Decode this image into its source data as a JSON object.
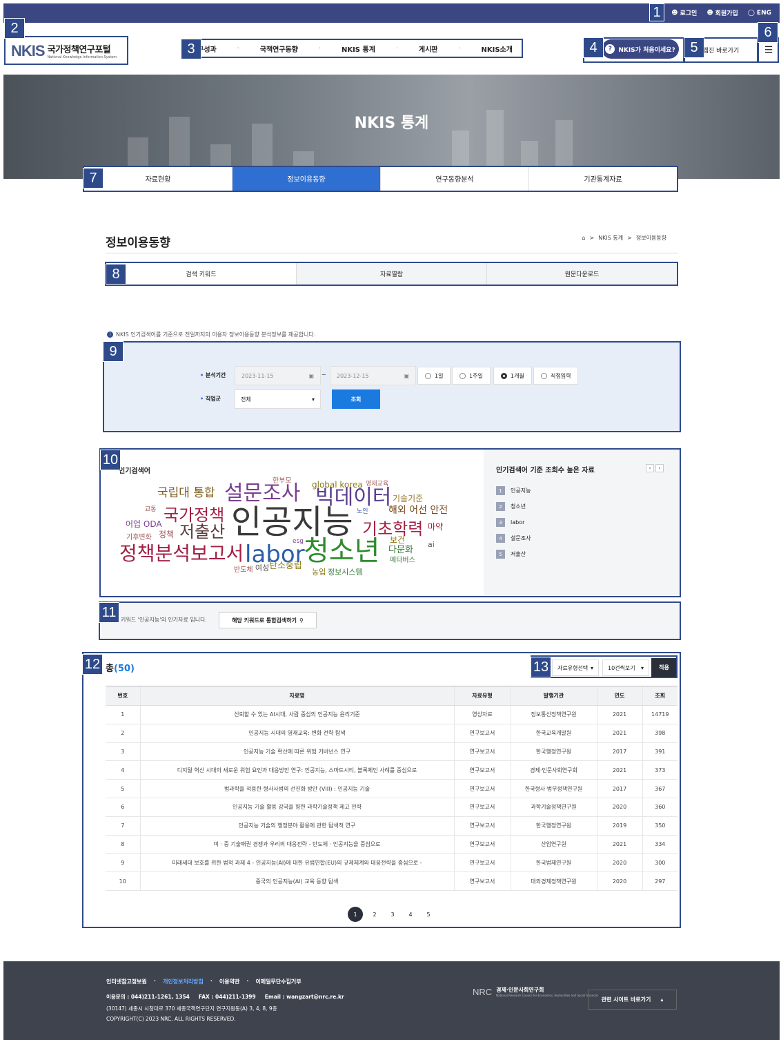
{
  "topbar": {
    "login": "로그인",
    "signup": "회원가입",
    "lang": "ENG"
  },
  "logo": {
    "mark": "NKIS",
    "title": "국가정책연구포털",
    "subtitle": "National Knowledge Information System"
  },
  "gnb": [
    "연구성과",
    "국책연구동향",
    "NKIS 통계",
    "게시판",
    "NKIS소개"
  ],
  "header": {
    "first_time": "NKIS가 처음이세요?",
    "webzine": "웹진 바로가기"
  },
  "hero": {
    "title": "NKIS 통계"
  },
  "main_tabs": [
    {
      "label": "자료현황"
    },
    {
      "label": "정보이용동향"
    },
    {
      "label": "연구동향분석"
    },
    {
      "label": "기관통계자료"
    }
  ],
  "page": {
    "title": "정보이용동향",
    "breadcrumb": [
      "NKIS 통계",
      "정보이용동향"
    ]
  },
  "sub_tabs": [
    {
      "label": "검색 키워드"
    },
    {
      "label": "자료열람"
    },
    {
      "label": "원문다운로드"
    }
  ],
  "info_text": "NKIS 인기검색어를 기준으로 전일까지의 이용자 정보이용동향 분석정보를 제공합니다.",
  "filter": {
    "period_label": "분석기간",
    "date_from": "2023-11-15",
    "date_sep": "~",
    "date_to": "2023-12-15",
    "periods": [
      "1일",
      "1주일",
      "1개월",
      "직접입력"
    ],
    "selected_period": "1개월",
    "job_label": "직업군",
    "job_value": "전체",
    "search_btn": "조회"
  },
  "wordcloud": {
    "title": "인기검색어",
    "words": [
      {
        "t": "인공지능",
        "c": "#3a3a3a"
      },
      {
        "t": "청소년",
        "c": "#2e8b2e"
      },
      {
        "t": "labor",
        "c": "#2b5fa8"
      },
      {
        "t": "설문조사",
        "c": "#7a3f8f"
      },
      {
        "t": "빅데이터",
        "c": "#5a3f8f"
      },
      {
        "t": "정책분석보고서",
        "c": "#a32045"
      },
      {
        "t": "국가정책",
        "c": "#a32045"
      },
      {
        "t": "저출산",
        "c": "#5a3a3a"
      },
      {
        "t": "기초학력",
        "c": "#a32045"
      },
      {
        "t": "국립대 통합",
        "c": "#7a5a1a"
      },
      {
        "t": "해외 어선 안전",
        "c": "#7a4a1a"
      },
      {
        "t": "global korea",
        "c": "#8a7a1a"
      },
      {
        "t": "기술기준",
        "c": "#9a7a2a"
      },
      {
        "t": "탄소중립",
        "c": "#8a7a1a"
      },
      {
        "t": "다문화",
        "c": "#3a7a3a"
      },
      {
        "t": "어업 ODA",
        "c": "#7a3f8f"
      },
      {
        "t": "정책",
        "c": "#a35a5a"
      },
      {
        "t": "보건",
        "c": "#8a7a1a"
      },
      {
        "t": "마약",
        "c": "#a32045"
      },
      {
        "t": "정보시스템",
        "c": "#3a7a3a"
      },
      {
        "t": "농업",
        "c": "#8a7a1a"
      },
      {
        "t": "여성",
        "c": "#555"
      },
      {
        "t": "한부모",
        "c": "#a35a5a"
      },
      {
        "t": "영재교육",
        "c": "#a35a5a"
      },
      {
        "t": "교통",
        "c": "#a35a5a"
      },
      {
        "t": "노인",
        "c": "#3a5aa8"
      },
      {
        "t": "기후변화",
        "c": "#a35a5a"
      },
      {
        "t": "esg",
        "c": "#7a3f8f"
      },
      {
        "t": "ai",
        "c": "#555"
      },
      {
        "t": "반도체",
        "c": "#a35a5a"
      },
      {
        "t": "메타버스",
        "c": "#3a7a3a"
      }
    ]
  },
  "popular": {
    "title": "인기검색어 기준 조회수 높은 자료",
    "items": [
      {
        "n": "1",
        "label": "인공지능"
      },
      {
        "n": "2",
        "label": "청소년"
      },
      {
        "n": "3",
        "label": "labor"
      },
      {
        "n": "4",
        "label": "설문조사"
      },
      {
        "n": "5",
        "label": "저출산"
      }
    ]
  },
  "keyword_bar": {
    "text": "키워드 '인공지능'의 인기자료 입니다.",
    "button": "해당 키워드로 통합검색하기"
  },
  "results": {
    "total_label": "총",
    "total_count": "(50)",
    "type_select": "자료유형선택",
    "per_page": "10건씩보기",
    "apply": "적용",
    "columns": [
      "번호",
      "자료명",
      "자료유형",
      "발행기관",
      "연도",
      "조회"
    ],
    "rows": [
      [
        "1",
        "신뢰할 수 있는 AI시대, 사람 중심의 인공지능 윤리기준",
        "영상자료",
        "정보통신정책연구원",
        "2021",
        "14719"
      ],
      [
        "2",
        "인공지능 시대의 영재교육: 변화 전략 탐색",
        "연구보고서",
        "한국교육개발원",
        "2021",
        "398"
      ],
      [
        "3",
        "인공지능 기술 확산에 따른 위험 거버넌스 연구",
        "연구보고서",
        "한국행정연구원",
        "2017",
        "391"
      ],
      [
        "4",
        "디지털 혁신 시대의 새로운 위험 요인과 대응방안 연구: 인공지능, 스마트시티, 블록체인 사례를 중심으로",
        "연구보고서",
        "경제·인문사회연구회",
        "2021",
        "373"
      ],
      [
        "5",
        "법과학을 적용한 형사사법의 선진화 방안 (VIII) : 인공지능 기술",
        "연구보고서",
        "한국형사·법무정책연구원",
        "2017",
        "367"
      ],
      [
        "6",
        "인공지능 기술 활용 강국을 향한 과학기술정책 제고 전략",
        "연구보고서",
        "과학기술정책연구원",
        "2020",
        "360"
      ],
      [
        "7",
        "인공지능 기술의 행정분야 활용에 관한 탐색적 연구",
        "연구보고서",
        "한국행정연구원",
        "2019",
        "350"
      ],
      [
        "8",
        "미 · 중 기술패권 경쟁과 우리의 대응전략 - 반도체 · 인공지능을 중심으로",
        "연구보고서",
        "산업연구원",
        "2021",
        "334"
      ],
      [
        "9",
        "미래세대 보호를 위한 법적 과제 4 - 인공지능(AI)에 대한 유럽연합(EU)의 규제체계와 대응전략을 중심으로 -",
        "연구보고서",
        "한국법제연구원",
        "2020",
        "300"
      ],
      [
        "10",
        "중국의 인공지능(AI) 교육 동향 탐색",
        "연구보고서",
        "대외경제정책연구원",
        "2020",
        "297"
      ]
    ],
    "pages": [
      "1",
      "2",
      "3",
      "4",
      "5"
    ]
  },
  "footer": {
    "links": [
      "인터넷참고정보원",
      "개인정보처리방침",
      "이용약관",
      "이메일무단수집거부"
    ],
    "contact": "이용문의 : 044)211-1261, 1354     FAX : 044)211-1399     Email : wangzart@nrc.re.kr",
    "address": "(30147) 세종시 시청대로 370 세종국책연구단지 연구지원동(A) 3, 4, 8, 9층",
    "copyright": "COPYRIGHT(C) 2023 NRC. ALL RIGHTS RESERVED.",
    "org_logo": "NRC",
    "org_name": "경제·인문사회연구회",
    "org_name_en": "National Research Council for Economics, Humanities and Social Sciences",
    "related": "관련 사이트 바로가기"
  },
  "annotations": [
    "1",
    "2",
    "3",
    "4",
    "5",
    "6",
    "7",
    "8",
    "9",
    "10",
    "11",
    "12",
    "13"
  ]
}
